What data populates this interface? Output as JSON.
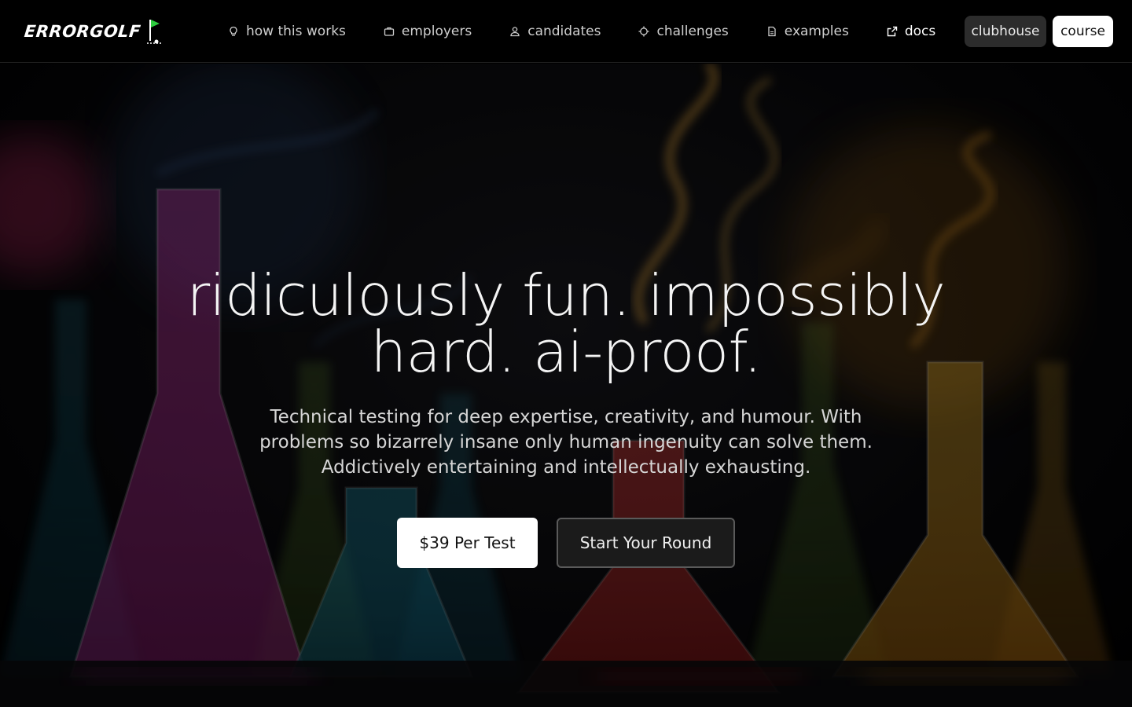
{
  "brand": {
    "name": "ERRORGOLF",
    "flag_color": "#2ecc40"
  },
  "nav": {
    "links": [
      {
        "label": "how this works",
        "icon": "lightbulb-icon"
      },
      {
        "label": "employers",
        "icon": "briefcase-icon"
      },
      {
        "label": "candidates",
        "icon": "user-icon"
      },
      {
        "label": "challenges",
        "icon": "target-icon"
      },
      {
        "label": "examples",
        "icon": "document-icon"
      },
      {
        "label": "docs",
        "icon": "external-link-icon"
      }
    ],
    "clubhouse_label": "clubhouse",
    "course_label": "course"
  },
  "hero": {
    "headline_line1": "ridiculously fun. impossibly",
    "headline_line2": "hard. ai-proof.",
    "subtext_line1": "Technical testing for deep expertise, creativity, and humour. With",
    "subtext_line2": "problems so bizarrely insane only human ingenuity can solve them.",
    "subtext_line3": "Addictively entertaining and intellectually exhausting.",
    "price_button": "$39 Per Test",
    "start_button": "Start Your Round",
    "background": "laboratory-flasks-with-colored-smoke"
  },
  "colors": {
    "page_bg": "#000000",
    "accent_primary": "#ffffff",
    "accent_secondary": "#2c2c2c"
  }
}
